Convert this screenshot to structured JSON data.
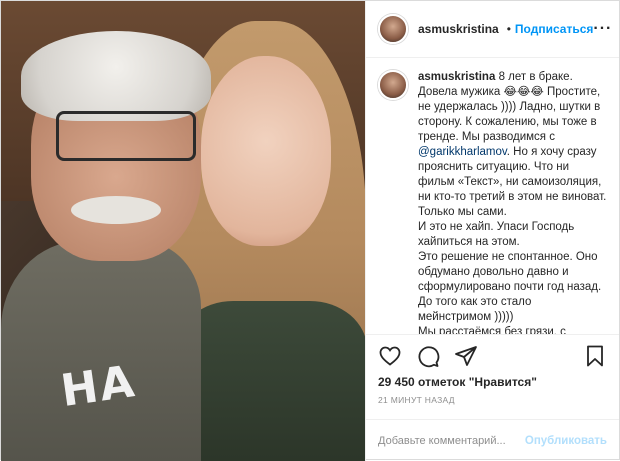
{
  "post": {
    "username": "asmuskristina",
    "follow_label": "Подписаться",
    "more_label": "···",
    "caption": {
      "username": "asmuskristina",
      "text_before_mention": "8 лет в браке.\nДовела мужика 😂😂😂 Простите, не удержалась )))) Ладно, шутки в сторону. К сожалению, мы тоже в тренде. Мы разводимся с ",
      "mention": "@garikkharlamov",
      "text_after_mention": ". Но я хочу сразу прояснить ситуацию. Что ни фильм «Текст», ни самоизоляция, ни кто-то третий в этом не виноват. Только мы сами.\nИ это не хайп. Упаси Господь хайпиться на этом.\nЭто решение не спонтанное. Оно обдумано довольно давно и сформулировано почти год назад. До того как это стало мейнстримом )))))\nМы расстаёмся без грязи, с большим уважением друг к другу. И я сейчас переполнена"
    },
    "likes": "29 450 отметок \"Нравится\"",
    "time_ago": "21 МИНУТ НАЗАД",
    "comment": {
      "placeholder": "Добавьте комментарий...",
      "post_label": "Опубликовать"
    },
    "photo_shirt_text": "НА",
    "icons": [
      "heart-icon",
      "comment-icon",
      "share-icon",
      "bookmark-icon",
      "verified-icon"
    ],
    "colors": {
      "accent": "#0095f6",
      "post_disabled": "#b2dffc",
      "mention": "#00376b",
      "verified": "#3897f0"
    }
  }
}
